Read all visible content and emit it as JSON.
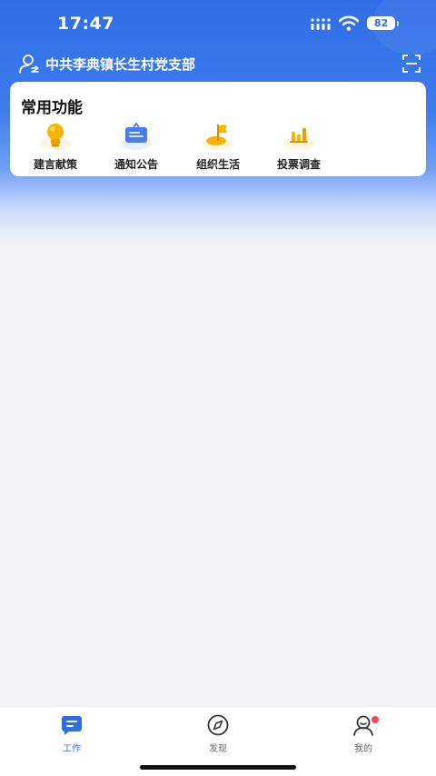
{
  "status_bar": {
    "time": "17:47",
    "battery": "82"
  },
  "header": {
    "org_name": "中共李典镇长生村党支部"
  },
  "quick_functions": {
    "title": "常用功能",
    "items": [
      {
        "label": "建言献策",
        "icon": "lightbulb-icon"
      },
      {
        "label": "通知公告",
        "icon": "notice-board-icon"
      },
      {
        "label": "组织生活",
        "icon": "party-flag-icon"
      },
      {
        "label": "投票调查",
        "icon": "bar-chart-icon"
      }
    ]
  },
  "tab_bar": {
    "items": [
      {
        "label": "工作",
        "icon": "work-icon",
        "active": true
      },
      {
        "label": "发现",
        "icon": "compass-icon",
        "active": false
      },
      {
        "label": "我的",
        "icon": "profile-icon",
        "active": false
      }
    ]
  },
  "colors": {
    "primary": "#2f6ee6",
    "badge": "#f04b4b",
    "accent_yellow": "#f7b500"
  }
}
